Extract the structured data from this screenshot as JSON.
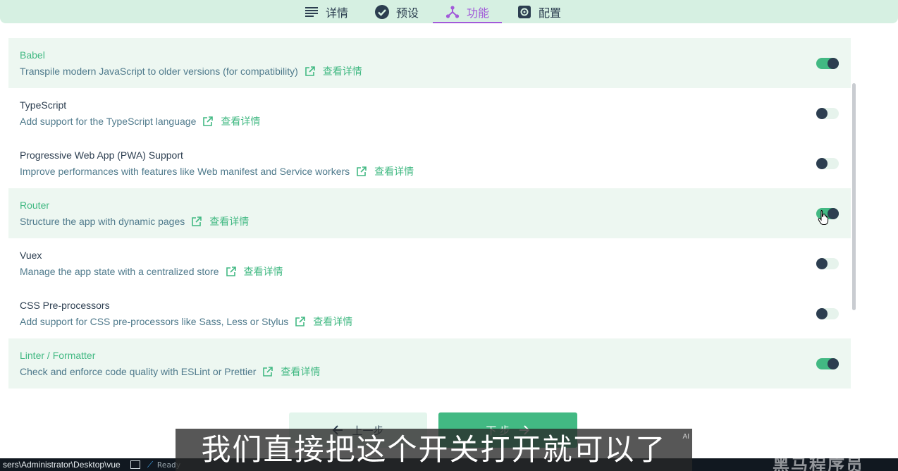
{
  "tabs": [
    {
      "label": "详情",
      "icon": "list-icon"
    },
    {
      "label": "预设",
      "icon": "check-circle-icon"
    },
    {
      "label": "功能",
      "icon": "fork-icon",
      "active": true
    },
    {
      "label": "配置",
      "icon": "settings-icon"
    }
  ],
  "features": [
    {
      "name": "Babel",
      "desc": "Transpile modern JavaScript to older versions (for compatibility)",
      "link": "查看详情",
      "enabled": true
    },
    {
      "name": "TypeScript",
      "desc": "Add support for the TypeScript language",
      "link": "查看详情",
      "enabled": false
    },
    {
      "name": "Progressive Web App (PWA) Support",
      "desc": "Improve performances with features like Web manifest and Service workers",
      "link": "查看详情",
      "enabled": false
    },
    {
      "name": "Router",
      "desc": "Structure the app with dynamic pages",
      "link": "查看详情",
      "enabled": true
    },
    {
      "name": "Vuex",
      "desc": "Manage the app state with a centralized store",
      "link": "查看详情",
      "enabled": false
    },
    {
      "name": "CSS Pre-processors",
      "desc": "Add support for CSS pre-processors like Sass, Less or Stylus",
      "link": "查看详情",
      "enabled": false
    },
    {
      "name": "Linter / Formatter",
      "desc": "Check and enforce code quality with ESLint or Prettier",
      "link": "查看详情",
      "enabled": true
    }
  ],
  "buttons": {
    "prev": "上一步",
    "next": "下 步"
  },
  "taskbar": {
    "path": "sers\\Administrator\\Desktop\\vue",
    "ready": "Ready"
  },
  "subtitle": {
    "text": "我们直接把这个开关打开就可以了",
    "ai": "AI"
  },
  "watermark": "黑马程序员",
  "colors": {
    "accent": "#42b983",
    "tab_active": "#a25ad9",
    "topbar": "#d6f0e2",
    "text": "#2c3e50"
  }
}
